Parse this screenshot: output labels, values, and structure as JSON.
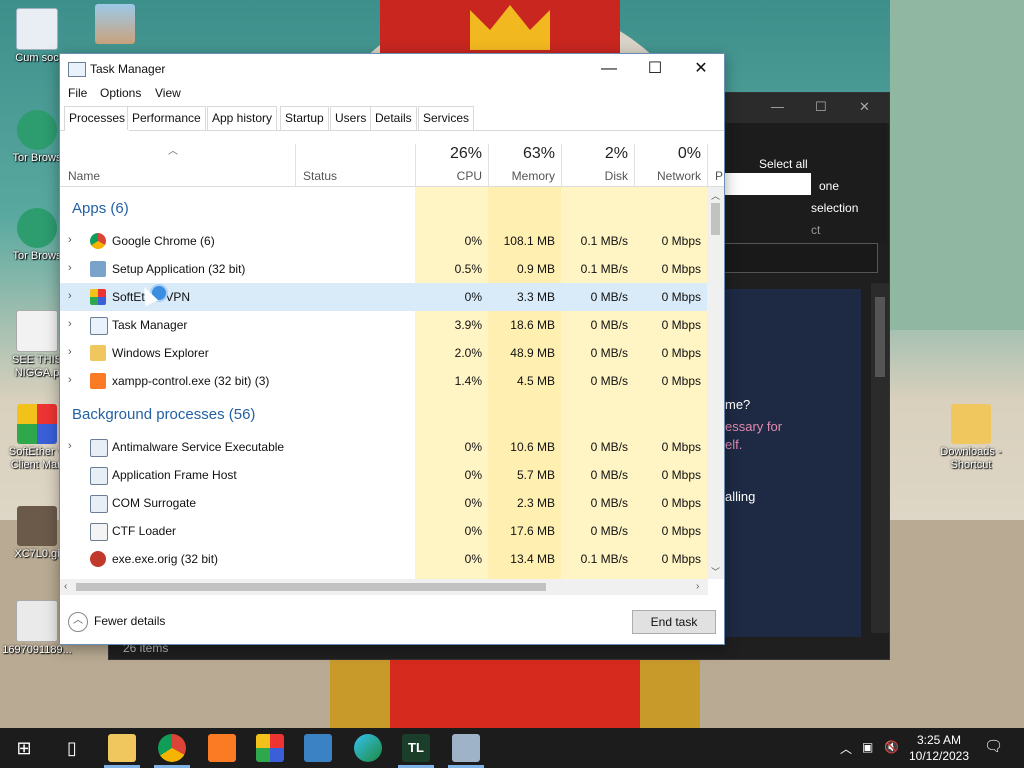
{
  "desktop_icons": [
    {
      "id": "recycle",
      "label": "Cum soc"
    },
    {
      "id": "picture1",
      "label": ""
    },
    {
      "id": "tor1",
      "label": "Tor Brows"
    },
    {
      "id": "tor2",
      "label": "Tor Brows"
    },
    {
      "id": "meme",
      "label": "SEE THIS NIGGA.p"
    },
    {
      "id": "softether",
      "label": "SoftEther V Client Man"
    },
    {
      "id": "gif",
      "label": "XC7L0.gi"
    },
    {
      "id": "jpg",
      "label": "1697091189..."
    },
    {
      "id": "downloads",
      "label": "Downloads - Shortcut"
    }
  ],
  "explorer": {
    "ribbon": [
      "Select all",
      "one",
      "selection",
      "ct"
    ],
    "panel_text": [
      "me?",
      "essary for",
      "elf.",
      "alling"
    ],
    "status": "26 items"
  },
  "taskmgr": {
    "title": "Task Manager",
    "menu": [
      "File",
      "Options",
      "View"
    ],
    "tabs": [
      "Processes",
      "Performance",
      "App history",
      "Startup",
      "Users",
      "Details",
      "Services"
    ],
    "columns": {
      "name": "Name",
      "status": "Status",
      "cpu": {
        "pct": "26%",
        "label": "CPU"
      },
      "memory": {
        "pct": "63%",
        "label": "Memory"
      },
      "disk": {
        "pct": "2%",
        "label": "Disk"
      },
      "network": {
        "pct": "0%",
        "label": "Network"
      },
      "power": "P"
    },
    "groups": {
      "apps": "Apps (6)",
      "background": "Background processes (56)"
    },
    "apps": [
      {
        "name": "Google Chrome (6)",
        "cpu": "0%",
        "mem": "108.1 MB",
        "disk": "0.1 MB/s",
        "net": "0 Mbps",
        "icon": "chrome-icon",
        "expand": true
      },
      {
        "name": "Setup Application (32 bit)",
        "cpu": "0.5%",
        "mem": "0.9 MB",
        "disk": "0.1 MB/s",
        "net": "0 Mbps",
        "icon": "setup-icon",
        "expand": true
      },
      {
        "name": "SoftEther VPN",
        "cpu": "0%",
        "mem": "3.3 MB",
        "disk": "0 MB/s",
        "net": "0 Mbps",
        "icon": "softether-icon",
        "expand": true
      },
      {
        "name": "Task Manager",
        "cpu": "3.9%",
        "mem": "18.6 MB",
        "disk": "0 MB/s",
        "net": "0 Mbps",
        "icon": "taskmgr-icon",
        "expand": true
      },
      {
        "name": "Windows Explorer",
        "cpu": "2.0%",
        "mem": "48.9 MB",
        "disk": "0 MB/s",
        "net": "0 Mbps",
        "icon": "folder-icon",
        "expand": true
      },
      {
        "name": "xampp-control.exe (32 bit) (3)",
        "cpu": "1.4%",
        "mem": "4.5 MB",
        "disk": "0 MB/s",
        "net": "0 Mbps",
        "icon": "xampp-icon",
        "expand": true
      }
    ],
    "background": [
      {
        "name": "Antimalware Service Executable",
        "cpu": "0%",
        "mem": "10.6 MB",
        "disk": "0 MB/s",
        "net": "0 Mbps",
        "icon": "service-icon",
        "expand": true
      },
      {
        "name": "Application Frame Host",
        "cpu": "0%",
        "mem": "5.7 MB",
        "disk": "0 MB/s",
        "net": "0 Mbps",
        "icon": "service-icon",
        "expand": false
      },
      {
        "name": "COM Surrogate",
        "cpu": "0%",
        "mem": "2.3 MB",
        "disk": "0 MB/s",
        "net": "0 Mbps",
        "icon": "service-icon",
        "expand": false
      },
      {
        "name": "CTF Loader",
        "cpu": "0%",
        "mem": "17.6 MB",
        "disk": "0 MB/s",
        "net": "0 Mbps",
        "icon": "ctf-icon",
        "expand": false
      },
      {
        "name": "exe.exe.orig (32 bit)",
        "cpu": "0%",
        "mem": "13.4 MB",
        "disk": "0.1 MB/s",
        "net": "0 Mbps",
        "icon": "exe-icon",
        "expand": false
      }
    ],
    "footer": {
      "fewer_details": "Fewer details",
      "end_task": "End task"
    }
  },
  "taskbar": {
    "items": [
      {
        "id": "start",
        "glyph": ""
      },
      {
        "id": "task-view",
        "glyph": ""
      },
      {
        "id": "explorer",
        "glyph": ""
      },
      {
        "id": "chrome",
        "glyph": ""
      },
      {
        "id": "xampp",
        "glyph": ""
      },
      {
        "id": "softether",
        "glyph": ""
      },
      {
        "id": "store",
        "glyph": ""
      },
      {
        "id": "edge",
        "glyph": ""
      },
      {
        "id": "tl",
        "glyph": "TL"
      },
      {
        "id": "taskmgr",
        "glyph": ""
      }
    ],
    "time": "3:25 AM",
    "date": "10/12/2023"
  }
}
